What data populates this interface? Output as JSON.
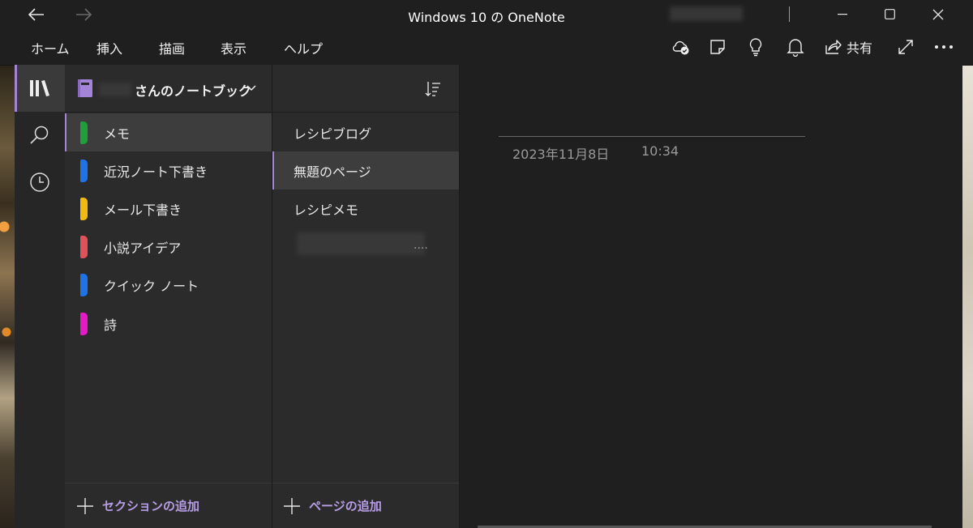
{
  "window": {
    "title": "Windows 10 の OneNote"
  },
  "menu": {
    "items": [
      "ホーム",
      "挿入",
      "描画",
      "表示",
      "ヘルプ"
    ]
  },
  "toolbar": {
    "share_label": "共有",
    "icons": [
      "sync-status-icon",
      "sticky-notes-icon",
      "lightbulb-icon",
      "bell-icon",
      "share-icon",
      "fullscreen-icon",
      "more-icon"
    ]
  },
  "rail": {
    "icons": [
      "notebooks-icon",
      "search-icon",
      "recent-icon"
    ]
  },
  "notebook": {
    "name": "さんのノートブック"
  },
  "sections": {
    "items": [
      {
        "label": "メモ",
        "color": "#1f9f3c"
      },
      {
        "label": "近況ノート下書き",
        "color": "#1e73e8"
      },
      {
        "label": "メール下書き",
        "color": "#f2b90f"
      },
      {
        "label": "小説アイデア",
        "color": "#e0525a"
      },
      {
        "label": "クイック ノート",
        "color": "#1e73e8"
      },
      {
        "label": "詩",
        "color": "#e619c7"
      }
    ],
    "add_label": "セクションの追加"
  },
  "pages": {
    "items": [
      {
        "label": "レシピブログ"
      },
      {
        "label": "無題のページ"
      },
      {
        "label": "レシピメモ"
      }
    ],
    "truncated_label": "....",
    "add_label": "ページの追加"
  },
  "page": {
    "date": "2023年11月8日",
    "time": "10:34"
  },
  "colors": {
    "accent": "#a484d6"
  }
}
